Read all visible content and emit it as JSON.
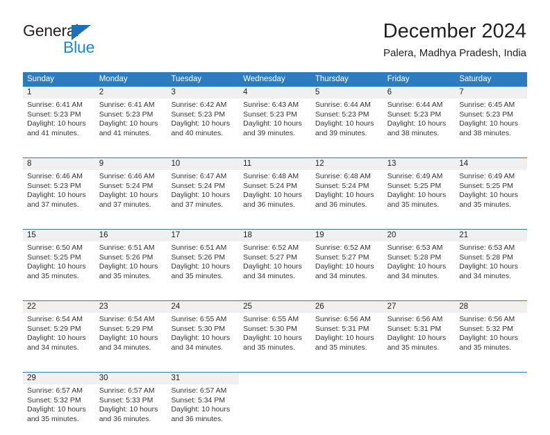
{
  "brand": {
    "name_top": "General",
    "name_bottom": "Blue",
    "triangle_icon": "triangle-icon",
    "accent_color": "#1a87dd",
    "triangle_color": "#1d6fb8"
  },
  "header": {
    "title": "December 2024",
    "subtitle": "Palera, Madhya Pradesh, India"
  },
  "calendar": {
    "header_bg": "#2d7cc0",
    "daynum_bg": "#f0f0f0",
    "weekdays": [
      "Sunday",
      "Monday",
      "Tuesday",
      "Wednesday",
      "Thursday",
      "Friday",
      "Saturday"
    ],
    "weeks": [
      [
        {
          "day": "1",
          "sunrise": "Sunrise: 6:41 AM",
          "sunset": "Sunset: 5:23 PM",
          "daylight_1": "Daylight: 10 hours",
          "daylight_2": "and 41 minutes."
        },
        {
          "day": "2",
          "sunrise": "Sunrise: 6:41 AM",
          "sunset": "Sunset: 5:23 PM",
          "daylight_1": "Daylight: 10 hours",
          "daylight_2": "and 41 minutes."
        },
        {
          "day": "3",
          "sunrise": "Sunrise: 6:42 AM",
          "sunset": "Sunset: 5:23 PM",
          "daylight_1": "Daylight: 10 hours",
          "daylight_2": "and 40 minutes."
        },
        {
          "day": "4",
          "sunrise": "Sunrise: 6:43 AM",
          "sunset": "Sunset: 5:23 PM",
          "daylight_1": "Daylight: 10 hours",
          "daylight_2": "and 39 minutes."
        },
        {
          "day": "5",
          "sunrise": "Sunrise: 6:44 AM",
          "sunset": "Sunset: 5:23 PM",
          "daylight_1": "Daylight: 10 hours",
          "daylight_2": "and 39 minutes."
        },
        {
          "day": "6",
          "sunrise": "Sunrise: 6:44 AM",
          "sunset": "Sunset: 5:23 PM",
          "daylight_1": "Daylight: 10 hours",
          "daylight_2": "and 38 minutes."
        },
        {
          "day": "7",
          "sunrise": "Sunrise: 6:45 AM",
          "sunset": "Sunset: 5:23 PM",
          "daylight_1": "Daylight: 10 hours",
          "daylight_2": "and 38 minutes."
        }
      ],
      [
        {
          "day": "8",
          "sunrise": "Sunrise: 6:46 AM",
          "sunset": "Sunset: 5:23 PM",
          "daylight_1": "Daylight: 10 hours",
          "daylight_2": "and 37 minutes."
        },
        {
          "day": "9",
          "sunrise": "Sunrise: 6:46 AM",
          "sunset": "Sunset: 5:24 PM",
          "daylight_1": "Daylight: 10 hours",
          "daylight_2": "and 37 minutes."
        },
        {
          "day": "10",
          "sunrise": "Sunrise: 6:47 AM",
          "sunset": "Sunset: 5:24 PM",
          "daylight_1": "Daylight: 10 hours",
          "daylight_2": "and 37 minutes."
        },
        {
          "day": "11",
          "sunrise": "Sunrise: 6:48 AM",
          "sunset": "Sunset: 5:24 PM",
          "daylight_1": "Daylight: 10 hours",
          "daylight_2": "and 36 minutes."
        },
        {
          "day": "12",
          "sunrise": "Sunrise: 6:48 AM",
          "sunset": "Sunset: 5:24 PM",
          "daylight_1": "Daylight: 10 hours",
          "daylight_2": "and 36 minutes."
        },
        {
          "day": "13",
          "sunrise": "Sunrise: 6:49 AM",
          "sunset": "Sunset: 5:25 PM",
          "daylight_1": "Daylight: 10 hours",
          "daylight_2": "and 35 minutes."
        },
        {
          "day": "14",
          "sunrise": "Sunrise: 6:49 AM",
          "sunset": "Sunset: 5:25 PM",
          "daylight_1": "Daylight: 10 hours",
          "daylight_2": "and 35 minutes."
        }
      ],
      [
        {
          "day": "15",
          "sunrise": "Sunrise: 6:50 AM",
          "sunset": "Sunset: 5:25 PM",
          "daylight_1": "Daylight: 10 hours",
          "daylight_2": "and 35 minutes."
        },
        {
          "day": "16",
          "sunrise": "Sunrise: 6:51 AM",
          "sunset": "Sunset: 5:26 PM",
          "daylight_1": "Daylight: 10 hours",
          "daylight_2": "and 35 minutes."
        },
        {
          "day": "17",
          "sunrise": "Sunrise: 6:51 AM",
          "sunset": "Sunset: 5:26 PM",
          "daylight_1": "Daylight: 10 hours",
          "daylight_2": "and 35 minutes."
        },
        {
          "day": "18",
          "sunrise": "Sunrise: 6:52 AM",
          "sunset": "Sunset: 5:27 PM",
          "daylight_1": "Daylight: 10 hours",
          "daylight_2": "and 34 minutes."
        },
        {
          "day": "19",
          "sunrise": "Sunrise: 6:52 AM",
          "sunset": "Sunset: 5:27 PM",
          "daylight_1": "Daylight: 10 hours",
          "daylight_2": "and 34 minutes."
        },
        {
          "day": "20",
          "sunrise": "Sunrise: 6:53 AM",
          "sunset": "Sunset: 5:28 PM",
          "daylight_1": "Daylight: 10 hours",
          "daylight_2": "and 34 minutes."
        },
        {
          "day": "21",
          "sunrise": "Sunrise: 6:53 AM",
          "sunset": "Sunset: 5:28 PM",
          "daylight_1": "Daylight: 10 hours",
          "daylight_2": "and 34 minutes."
        }
      ],
      [
        {
          "day": "22",
          "sunrise": "Sunrise: 6:54 AM",
          "sunset": "Sunset: 5:29 PM",
          "daylight_1": "Daylight: 10 hours",
          "daylight_2": "and 34 minutes."
        },
        {
          "day": "23",
          "sunrise": "Sunrise: 6:54 AM",
          "sunset": "Sunset: 5:29 PM",
          "daylight_1": "Daylight: 10 hours",
          "daylight_2": "and 34 minutes."
        },
        {
          "day": "24",
          "sunrise": "Sunrise: 6:55 AM",
          "sunset": "Sunset: 5:30 PM",
          "daylight_1": "Daylight: 10 hours",
          "daylight_2": "and 34 minutes."
        },
        {
          "day": "25",
          "sunrise": "Sunrise: 6:55 AM",
          "sunset": "Sunset: 5:30 PM",
          "daylight_1": "Daylight: 10 hours",
          "daylight_2": "and 35 minutes."
        },
        {
          "day": "26",
          "sunrise": "Sunrise: 6:56 AM",
          "sunset": "Sunset: 5:31 PM",
          "daylight_1": "Daylight: 10 hours",
          "daylight_2": "and 35 minutes."
        },
        {
          "day": "27",
          "sunrise": "Sunrise: 6:56 AM",
          "sunset": "Sunset: 5:31 PM",
          "daylight_1": "Daylight: 10 hours",
          "daylight_2": "and 35 minutes."
        },
        {
          "day": "28",
          "sunrise": "Sunrise: 6:56 AM",
          "sunset": "Sunset: 5:32 PM",
          "daylight_1": "Daylight: 10 hours",
          "daylight_2": "and 35 minutes."
        }
      ],
      [
        {
          "day": "29",
          "sunrise": "Sunrise: 6:57 AM",
          "sunset": "Sunset: 5:32 PM",
          "daylight_1": "Daylight: 10 hours",
          "daylight_2": "and 35 minutes."
        },
        {
          "day": "30",
          "sunrise": "Sunrise: 6:57 AM",
          "sunset": "Sunset: 5:33 PM",
          "daylight_1": "Daylight: 10 hours",
          "daylight_2": "and 36 minutes."
        },
        {
          "day": "31",
          "sunrise": "Sunrise: 6:57 AM",
          "sunset": "Sunset: 5:34 PM",
          "daylight_1": "Daylight: 10 hours",
          "daylight_2": "and 36 minutes."
        },
        {
          "day": "",
          "sunrise": "",
          "sunset": "",
          "daylight_1": "",
          "daylight_2": ""
        },
        {
          "day": "",
          "sunrise": "",
          "sunset": "",
          "daylight_1": "",
          "daylight_2": ""
        },
        {
          "day": "",
          "sunrise": "",
          "sunset": "",
          "daylight_1": "",
          "daylight_2": ""
        },
        {
          "day": "",
          "sunrise": "",
          "sunset": "",
          "daylight_1": "",
          "daylight_2": ""
        }
      ]
    ]
  }
}
